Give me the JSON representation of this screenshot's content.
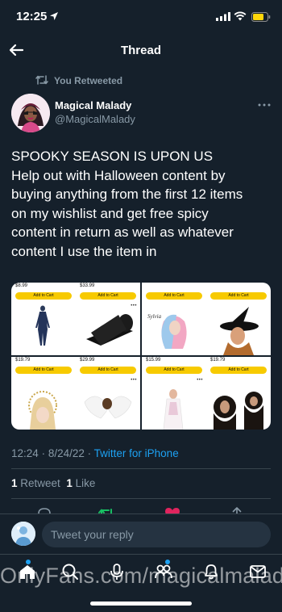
{
  "status_bar": {
    "time": "12:25"
  },
  "nav": {
    "title": "Thread"
  },
  "tweet": {
    "retweet_context": "You Retweeted",
    "author": {
      "display_name": "Magical Malady",
      "handle": "@MagicalMalady"
    },
    "text_lines": [
      "SPOOKY SEASON IS UPON US",
      "Help out with Halloween content by",
      "buying anything from the first 12 items",
      "on my wishlist and get free spicy",
      "content in return as well as whatever",
      "content I use the item in"
    ],
    "media": {
      "products": [
        {
          "price": "$8.99",
          "button": "Add to Cart"
        },
        {
          "price": "$33.99",
          "button": "Add to Cart"
        },
        {
          "price": "",
          "button": "Add to Cart",
          "caption": "Sylvia"
        },
        {
          "price": "",
          "button": "Add to Cart"
        },
        {
          "price": "$19.79",
          "button": "Add to Cart"
        },
        {
          "price": "$29.99",
          "button": "Add to Cart"
        },
        {
          "price": "$15.99",
          "button": "Add to Cart"
        },
        {
          "price": "$19.79",
          "button": "Add to Cart"
        }
      ]
    },
    "timestamp": {
      "time": "12:24",
      "separator": "·",
      "date": "8/24/22",
      "source": "Twitter for iPhone"
    },
    "stats": {
      "retweets_count": "1",
      "retweets_label": "Retweet",
      "likes_count": "1",
      "likes_label": "Like"
    }
  },
  "reply": {
    "placeholder": "Tweet your reply"
  },
  "watermark": "OnlyFans.com/magicalmalady",
  "colors": {
    "background": "#15202b",
    "accent": "#1da1f2",
    "muted_text": "#8899a6",
    "like": "#e0245e",
    "retweet": "#17bf63",
    "add_to_cart": "#f7ca00"
  },
  "icons": {
    "back": "arrow-left-icon",
    "more": "more-horizontal-icon",
    "reply": "comment-icon",
    "retweet": "retweet-icon",
    "like": "heart-icon",
    "share": "share-icon",
    "tabs": [
      "home-icon",
      "search-icon",
      "spaces-icon",
      "communities-icon",
      "notifications-icon",
      "messages-icon"
    ]
  }
}
